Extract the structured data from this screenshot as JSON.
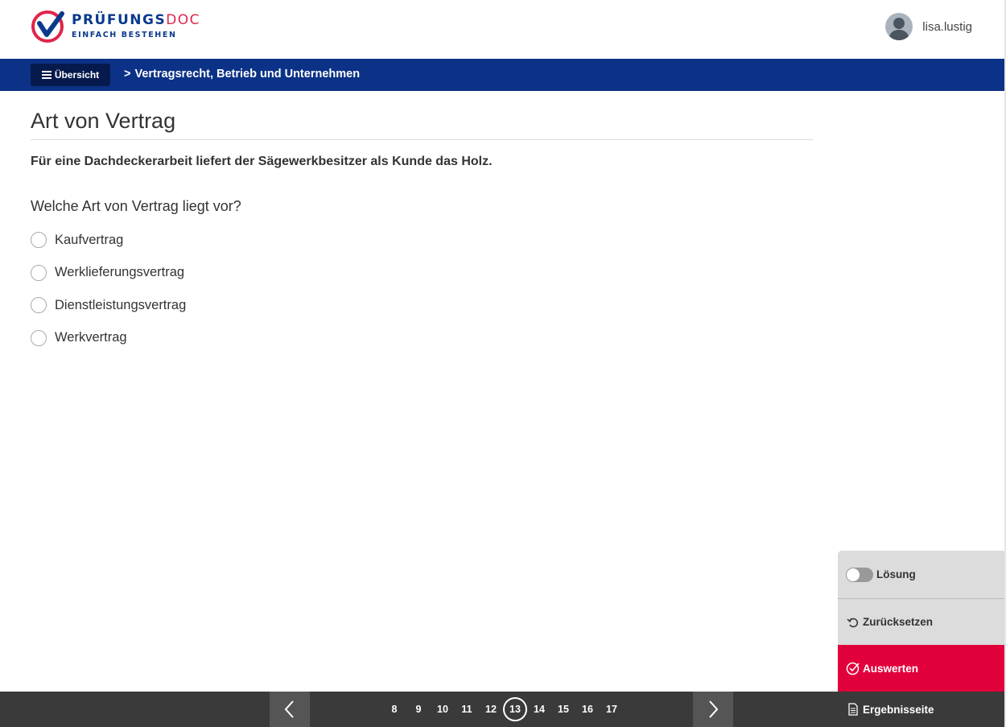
{
  "brand": {
    "name_main": "PRÜFUNGS",
    "name_accent": "DOC",
    "tagline": "EINFACH BESTEHEN",
    "colors": {
      "primary": "#0b3286",
      "accent": "#e0244b"
    }
  },
  "user": {
    "name": "lisa.lustig",
    "icon": "user-avatar-icon"
  },
  "nav": {
    "overview_label": "Übersicht",
    "breadcrumb": "Vertragsrecht, Betrieb und Unternehmen"
  },
  "exercise": {
    "title": "Art von Vertrag",
    "statement": "Für eine Dachdeckerarbeit liefert der Sägewerkbesitzer als Kunde das Holz.",
    "question": "Welche Art von Vertrag liegt vor?",
    "options": [
      {
        "label": "Kaufvertrag",
        "selected": false
      },
      {
        "label": "Werklieferungsvertrag",
        "selected": false
      },
      {
        "label": "Dienstleistungsvertrag",
        "selected": false
      },
      {
        "label": "Werkvertrag",
        "selected": false
      }
    ]
  },
  "actions": {
    "solution_label": "Lösung",
    "solution_on": false,
    "reset_label": "Zurücksetzen",
    "evaluate_label": "Auswerten",
    "results_label": "Ergebnisseite",
    "evaluate_color": "#e2003c"
  },
  "pagination": {
    "pages": [
      "8",
      "9",
      "10",
      "11",
      "12",
      "13",
      "14",
      "15",
      "16",
      "17"
    ],
    "current": "13"
  }
}
